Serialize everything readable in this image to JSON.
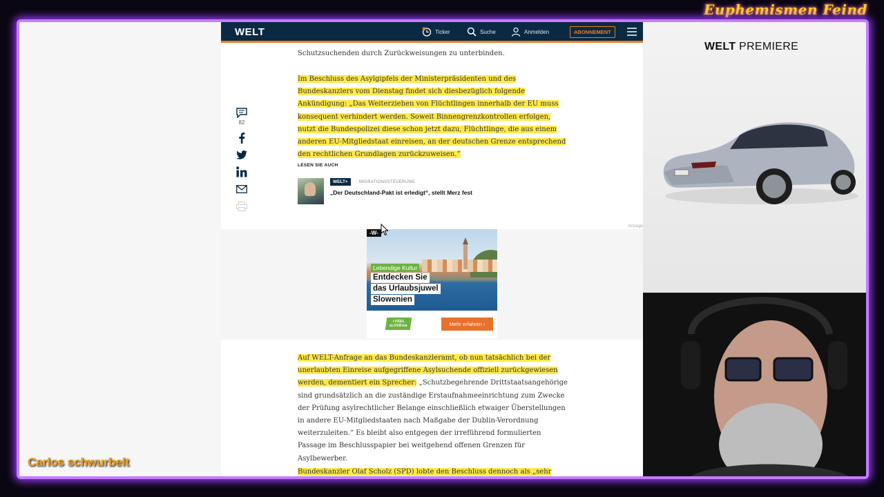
{
  "overlay": {
    "channel_logo": "Euphemismen Feind",
    "streamer_caption": "Carlos schwurbelt"
  },
  "header": {
    "logo": "WELT",
    "ticker_label": "Ticker",
    "search_label": "Suche",
    "login_label": "Anmelden",
    "subscribe_label": "ABONNEMENT"
  },
  "share": {
    "comment_count": "82"
  },
  "article": {
    "intro_text": "Schutzsuchenden durch Zurückweisungen zu unterbinden.",
    "para1": "Im Beschluss des Asylgipfels der Ministerpräsidenten und des Bundeskanzlers vom Dienstag findet sich diesbezüglich folgende Ankündigung: „Das Weiterziehen von Flüchtlingen innerhalb der EU muss konsequent verhindert werden. Soweit Binnengrenzkontrollen erfolgen, nutzt die Bundespolizei diese schon jetzt dazu, Flüchtlinge, die aus einem anderen EU-Mitgliedstaat einreisen, an der deutschen Grenze entsprechend den rechtlichen Grundlagen zurückzuweisen.“",
    "para2_highlight": "Auf WELT-Anfrage an das Bundeskanzleramt, ob nun tatsächlich bei der unerlaubten Einreise aufgegriffene Asylsuchende offiziell zurückgewiesen werden, dementiert ein Sprecher:",
    "para2_rest": " „Schutzbegehrende Drittstaatsangehörige sind grundsätzlich an die zuständige Erstaufnahmeeinrichtung zum Zwecke der Prüfung asylrechtlicher Belange einschließlich etwaiger Überstellungen in andere EU-Mitgliedstaaten nach Maßgabe der Dublin-Verordnung weiterzuleiten.“ Es bleibt also entgegen der irreführend formulierten Passage im Beschlusspapier bei weitgehend offenen Grenzen für Asylbewerber.",
    "para3": "Bundeskanzler Olaf Scholz (SPD) lobte den Beschluss dennoch als „sehr"
  },
  "related": {
    "label": "LESEN SIE AUCH",
    "badge": "WELT+",
    "kicker": "MIGRATIONSSTEUERUNG",
    "title": "„Der Deutschland-Pakt ist erledigt“, stellt Merz fest"
  },
  "ad": {
    "anzeige": "Anzeige",
    "w_badge": "-W-",
    "tag": "Lebendige Kultur",
    "line1": "Entdecken Sie",
    "line2": "das Urlaubsjuwel",
    "line3": "Slowenien",
    "feel_logo": "I FEEL sLOVEnia",
    "cta": "Mehr erfahren ›"
  },
  "premiere": {
    "logo_bold": "WELT",
    "logo_light": "PREMIERE"
  },
  "colors": {
    "welt_navy": "#0a2a44",
    "welt_orange": "#f07c1a",
    "highlight": "#ffe94a",
    "frame_glow": "#c77bff"
  }
}
